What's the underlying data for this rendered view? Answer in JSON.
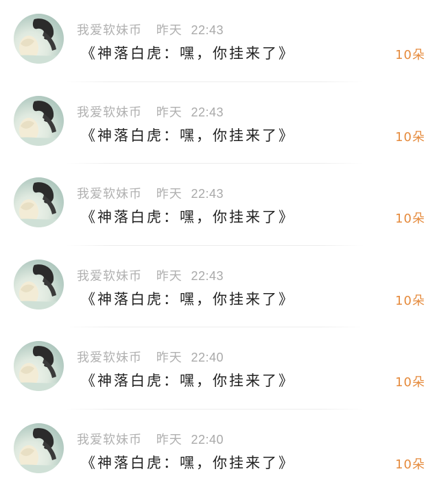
{
  "items": [
    {
      "name": "我爱软妹币",
      "day": "昨天",
      "time": "22:43",
      "message": "《神落白虎：嘿，你挂来了》",
      "count": "10朵"
    },
    {
      "name": "我爱软妹币",
      "day": "昨天",
      "time": "22:43",
      "message": "《神落白虎：嘿，你挂来了》",
      "count": "10朵"
    },
    {
      "name": "我爱软妹币",
      "day": "昨天",
      "time": "22:43",
      "message": "《神落白虎：嘿，你挂来了》",
      "count": "10朵"
    },
    {
      "name": "我爱软妹币",
      "day": "昨天",
      "time": "22:43",
      "message": "《神落白虎：嘿，你挂来了》",
      "count": "10朵"
    },
    {
      "name": "我爱软妹币",
      "day": "昨天",
      "time": "22:40",
      "message": "《神落白虎：嘿，你挂来了》",
      "count": "10朵"
    },
    {
      "name": "我爱软妹币",
      "day": "昨天",
      "time": "22:40",
      "message": "《神落白虎：嘿，你挂来了》",
      "count": "10朵"
    }
  ],
  "colors": {
    "count": "#e58a3c",
    "meta": "#b0b0b0",
    "message": "#222222"
  },
  "icons": {
    "avatar": "anime-girl-avatar"
  }
}
